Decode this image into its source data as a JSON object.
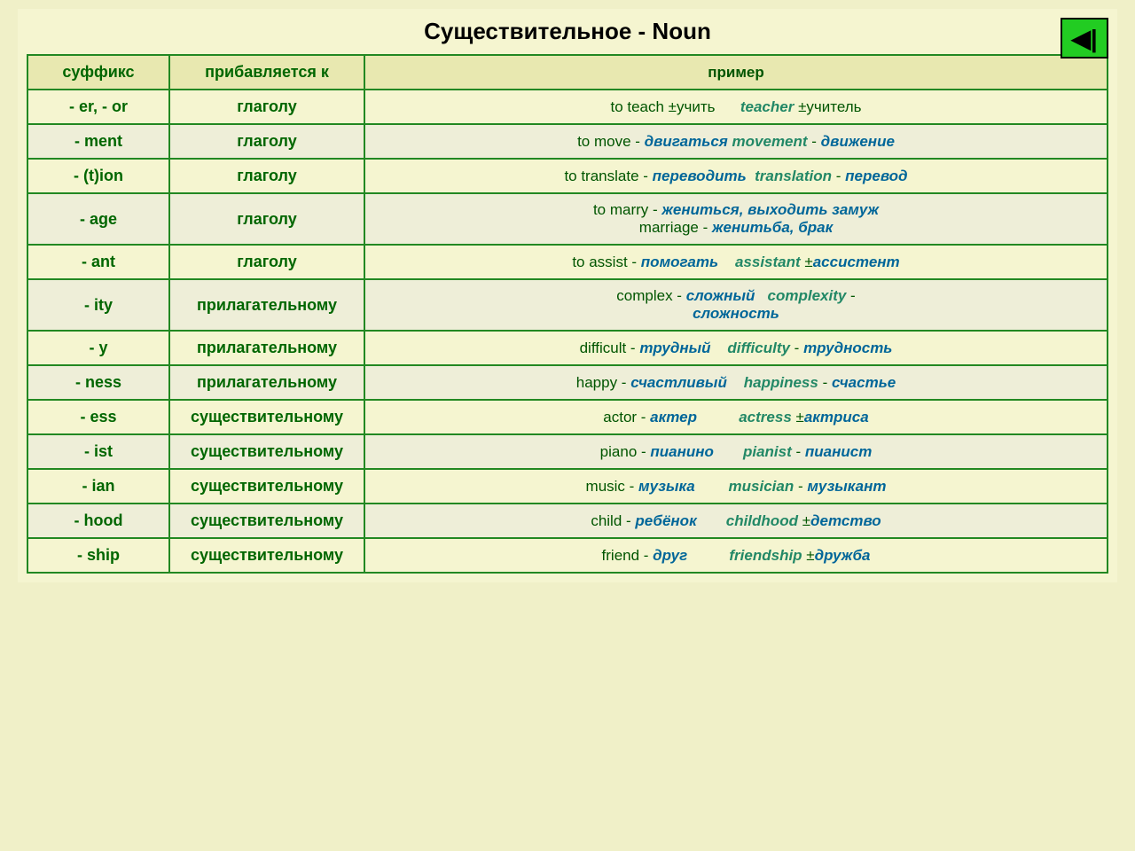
{
  "title": "Существительное - Noun",
  "nav_button_label": "◀|",
  "headers": {
    "suffix": "суффикс",
    "base": "прибавляется к",
    "example": "пример"
  },
  "rows": [
    {
      "suffix": "- er, - or",
      "base": "глаголу",
      "example_html": "er_or"
    },
    {
      "suffix": "- ment",
      "base": "глаголу",
      "example_html": "ment"
    },
    {
      "suffix": "- (t)ion",
      "base": "глаголу",
      "example_html": "tion"
    },
    {
      "suffix": "- age",
      "base": "глаголу",
      "example_html": "age"
    },
    {
      "suffix": "- ant",
      "base": "глаголу",
      "example_html": "ant"
    },
    {
      "suffix": "- ity",
      "base": "прилагательному",
      "example_html": "ity"
    },
    {
      "suffix": "- y",
      "base": "прилагательному",
      "example_html": "y"
    },
    {
      "suffix": "- ness",
      "base": "прилагательному",
      "example_html": "ness"
    },
    {
      "suffix": "- ess",
      "base": "существительному",
      "example_html": "ess"
    },
    {
      "suffix": "- ist",
      "base": "существительному",
      "example_html": "ist"
    },
    {
      "suffix": "- ian",
      "base": "существительному",
      "example_html": "ian"
    },
    {
      "suffix": "- hood",
      "base": "существительному",
      "example_html": "hood"
    },
    {
      "suffix": "- ship",
      "base": "существительному",
      "example_html": "ship"
    }
  ]
}
